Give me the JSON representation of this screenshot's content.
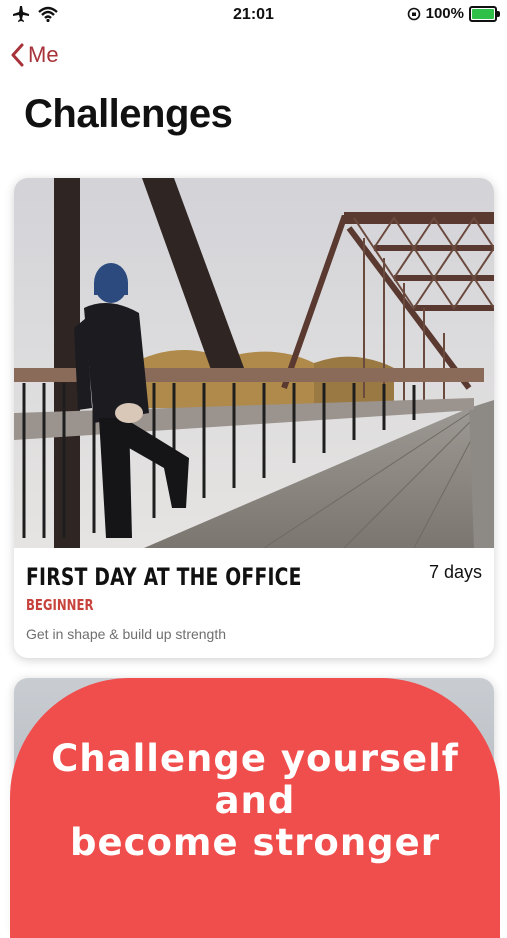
{
  "status_bar": {
    "time": "21:01",
    "battery_percent": "100%",
    "icons": [
      "airplane-icon",
      "wifi-icon",
      "orientation-lock-icon",
      "battery-charging-icon"
    ]
  },
  "nav": {
    "back_label": "Me"
  },
  "page": {
    "title": "Challenges"
  },
  "cards": [
    {
      "title": "FIRST DAY AT THE OFFICE",
      "duration": "7 days",
      "level": "BEGINNER",
      "description": "Get in shape & build up strength",
      "image": "man-stretching-on-bridge-photo"
    }
  ],
  "promo": {
    "line1": "Challenge yourself",
    "line2": "and",
    "line3": "become stronger"
  },
  "colors": {
    "accent": "#a8323a",
    "level": "#c8423c",
    "promo": "#f04e4d"
  }
}
